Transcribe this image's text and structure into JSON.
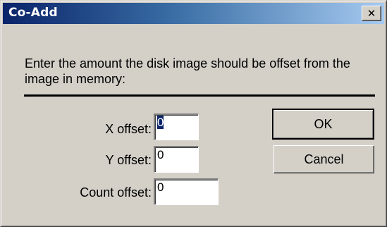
{
  "window": {
    "title": "Co-Add",
    "close_glyph": "✕"
  },
  "prompt": {
    "text": "Enter the amount the disk image should be offset from the image in memory:"
  },
  "fields": {
    "x_offset": {
      "label": "X offset:",
      "value": "0"
    },
    "y_offset": {
      "label": "Y offset:",
      "value": "0"
    },
    "count_offset": {
      "label": "Count offset:",
      "value": "0"
    }
  },
  "buttons": {
    "ok_label": "OK",
    "cancel_label": "Cancel"
  },
  "colors": {
    "titlebar_start": "#0a246a",
    "titlebar_end": "#a6caf0",
    "dialog_face": "#d4d0c8",
    "selection": "#0a246a"
  }
}
